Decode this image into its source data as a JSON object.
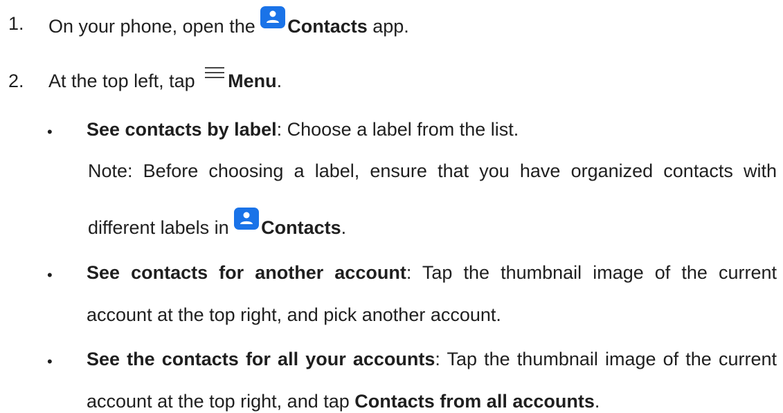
{
  "steps": [
    {
      "number": "1.",
      "pre": "On your phone, open the ",
      "icon": "contacts-app-icon",
      "bold": "Contacts",
      "post": " app."
    },
    {
      "number": "2.",
      "pre": "At the top left, tap ",
      "icon": "menu-icon",
      "bold": "Menu",
      "post": "."
    }
  ],
  "bullets": [
    {
      "symbol": "•",
      "bold": "See contacts by label",
      "text": ": Choose a label from the list."
    },
    {
      "symbol": "•",
      "bold": "See contacts for another account",
      "text_line1": ": Tap the thumbnail image of the current",
      "text_line2": "account at the top right, and pick another account."
    },
    {
      "symbol": "•",
      "bold": "See the contacts for all your accounts",
      "text_line1": ": Tap the thumbnail image of the current",
      "text_line2_pre": "account at the top right, and tap ",
      "text_line2_bold": "Contacts from all accounts",
      "text_line2_post": "."
    }
  ],
  "note": {
    "line1": "Note: Before choosing a label, ensure that you have organized contacts with",
    "line2_pre": "different labels in ",
    "icon": "contacts-app-icon",
    "line2_bold": "Contacts",
    "line2_post": "."
  },
  "colors": {
    "icon_blue": "#1a73e8",
    "text": "#1f1f1f"
  }
}
